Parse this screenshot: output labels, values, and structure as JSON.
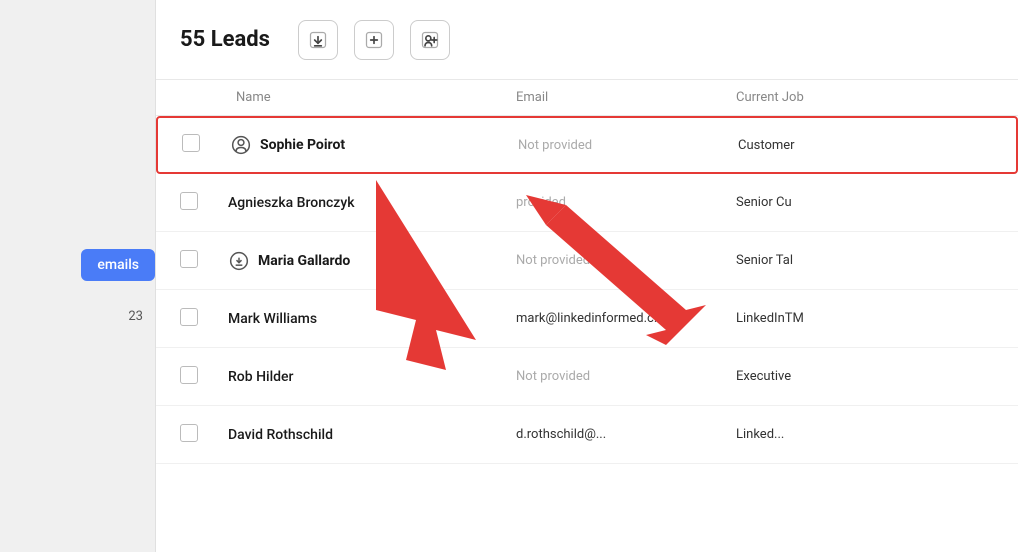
{
  "sidebar": {
    "emails_button": "emails",
    "year": "23"
  },
  "header": {
    "title": "55 Leads",
    "icon1": "download",
    "icon2": "upload",
    "icon3": "person-add"
  },
  "table": {
    "columns": [
      "",
      "Name",
      "Email",
      "Current Job"
    ],
    "rows": [
      {
        "id": 1,
        "name": "Sophie Poirot",
        "icon": "person-circle",
        "bold": true,
        "highlighted": true,
        "email": "Not provided",
        "email_real": false,
        "job": "Customer"
      },
      {
        "id": 2,
        "name": "Agnieszka Bronczyk",
        "icon": null,
        "bold": false,
        "highlighted": false,
        "email": "provided",
        "email_real": false,
        "job": "Senior Cu"
      },
      {
        "id": 3,
        "name": "Maria Gallardo",
        "icon": "download-circle",
        "bold": true,
        "highlighted": false,
        "email": "Not provided",
        "email_real": false,
        "job": "Senior Tal"
      },
      {
        "id": 4,
        "name": "Mark Williams",
        "icon": null,
        "bold": false,
        "highlighted": false,
        "email": "mark@linkedinformed.c...",
        "email_real": true,
        "job": "LinkedInTM"
      },
      {
        "id": 5,
        "name": "Rob Hilder",
        "icon": null,
        "bold": false,
        "highlighted": false,
        "email": "Not provided",
        "email_real": false,
        "job": "Executive"
      },
      {
        "id": 6,
        "name": "David Rothschild",
        "icon": null,
        "bold": false,
        "highlighted": false,
        "email": "d.rothschild@...",
        "email_real": true,
        "job": "Linked..."
      }
    ]
  }
}
